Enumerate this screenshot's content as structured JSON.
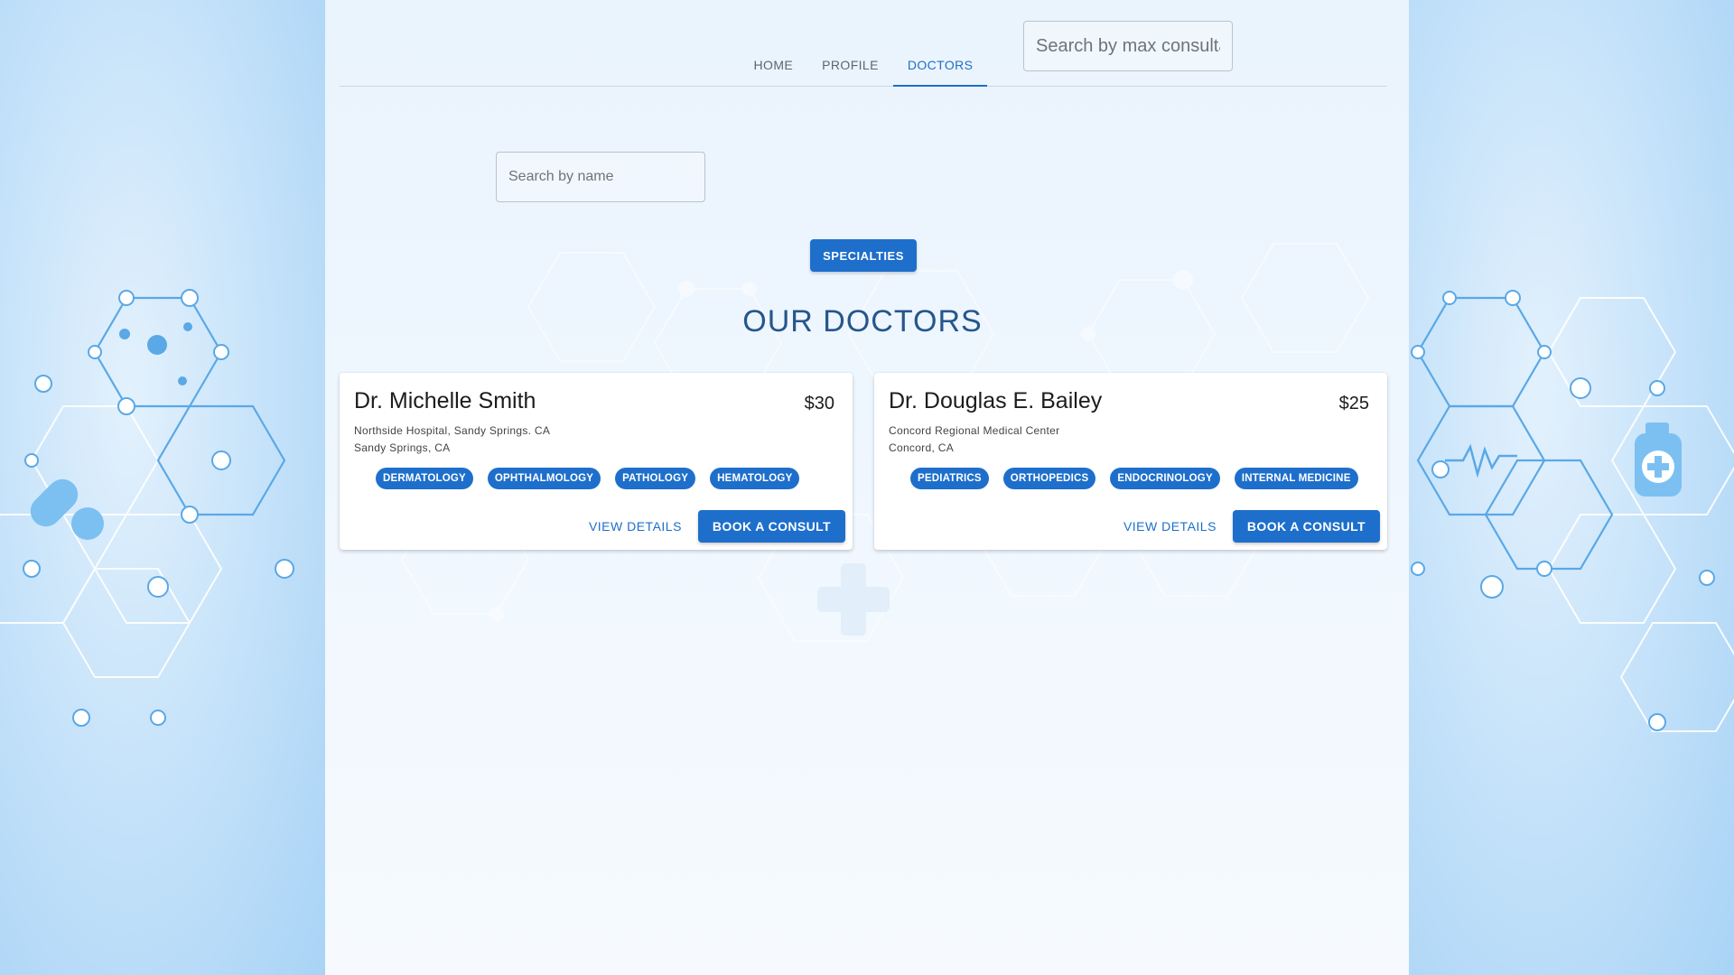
{
  "nav": {
    "tabs": [
      {
        "label": "HOME"
      },
      {
        "label": "PROFILE"
      },
      {
        "label": "DOCTORS"
      }
    ],
    "active_tab": "DOCTORS"
  },
  "search": {
    "name_placeholder": "Search by name",
    "price_placeholder": "Search by max consulta..."
  },
  "specialties_button": "SPECIALTIES",
  "heading": "OUR DOCTORS",
  "doctors": [
    {
      "name": "Dr. Michelle Smith",
      "price": "$30",
      "hospital": "Northside Hospital, Sandy Springs. CA",
      "city": "Sandy Springs, CA",
      "specialties": [
        "DERMATOLOGY",
        "OPHTHALMOLOGY",
        "PATHOLOGY",
        "HEMATOLOGY"
      ],
      "details_label": "VIEW DETAILS",
      "book_label": "BOOK A CONSULT"
    },
    {
      "name": "Dr. Douglas E. Bailey",
      "price": "$25",
      "hospital": "Concord Regional Medical Center",
      "city": "Concord, CA",
      "specialties": [
        "PEDIATRICS",
        "ORTHOPEDICS",
        "ENDOCRINOLOGY",
        "INTERNAL MEDICINE"
      ],
      "details_label": "VIEW DETAILS",
      "book_label": "BOOK A CONSULT"
    }
  ],
  "colors": {
    "primary": "#1e6fcb",
    "heading": "#26568c",
    "background": "#eaf4fd"
  }
}
